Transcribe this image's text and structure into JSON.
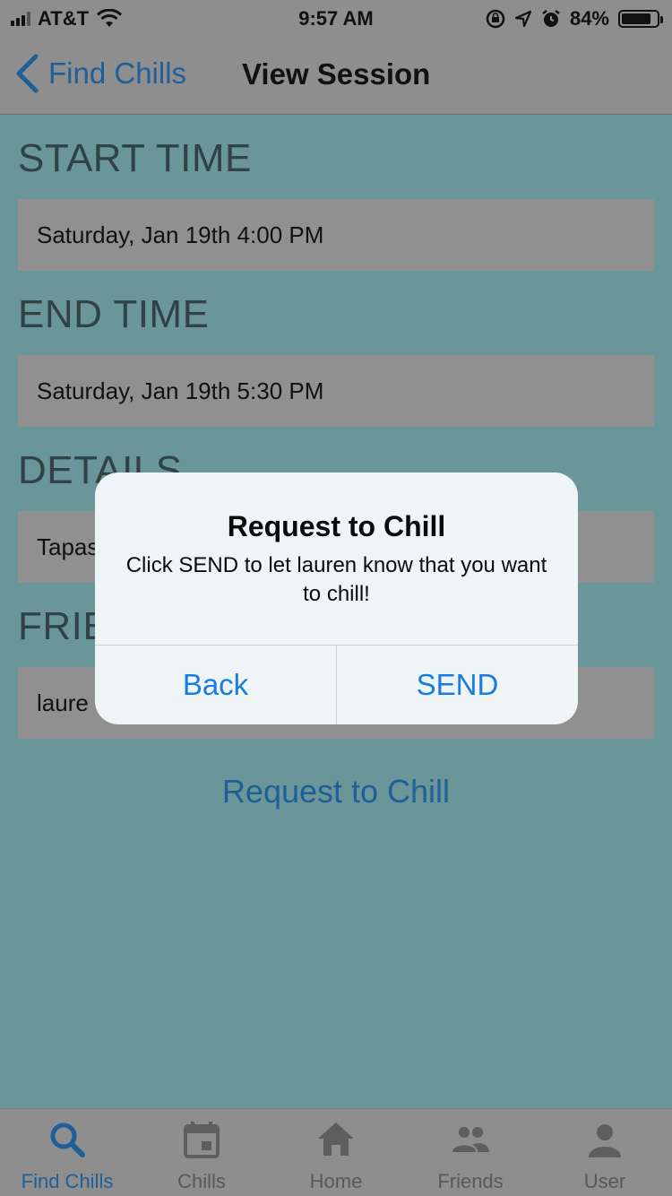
{
  "status_bar": {
    "carrier": "AT&T",
    "time": "9:57 AM",
    "battery": "84%",
    "battery_level": 0.84
  },
  "nav": {
    "back_label": "Find Chills",
    "title": "View Session"
  },
  "sections": {
    "start_time": {
      "label": "START TIME",
      "value": "Saturday, Jan 19th 4:00 PM"
    },
    "end_time": {
      "label": "END TIME",
      "value": "Saturday, Jan 19th 5:30 PM"
    },
    "details": {
      "label": "DETAILS",
      "value": "Tapas"
    },
    "friend": {
      "label": "FRIE",
      "value": "laure"
    }
  },
  "request_link": "Request to Chill",
  "alert": {
    "title": "Request to Chill",
    "message": "Click SEND to let lauren know that you want to chill!",
    "back_label": "Back",
    "send_label": "SEND"
  },
  "tabs": [
    {
      "label": "Find Chills",
      "icon": "search-icon",
      "active": true
    },
    {
      "label": "Chills",
      "icon": "calendar-icon",
      "active": false
    },
    {
      "label": "Home",
      "icon": "home-icon",
      "active": false
    },
    {
      "label": "Friends",
      "icon": "friends-icon",
      "active": false
    },
    {
      "label": "User",
      "icon": "user-icon",
      "active": false
    }
  ],
  "colors": {
    "background": "#6b9699",
    "bars": "#8e8e8e",
    "accent": "#1f5f98",
    "alert_button": "#1a7be0"
  }
}
